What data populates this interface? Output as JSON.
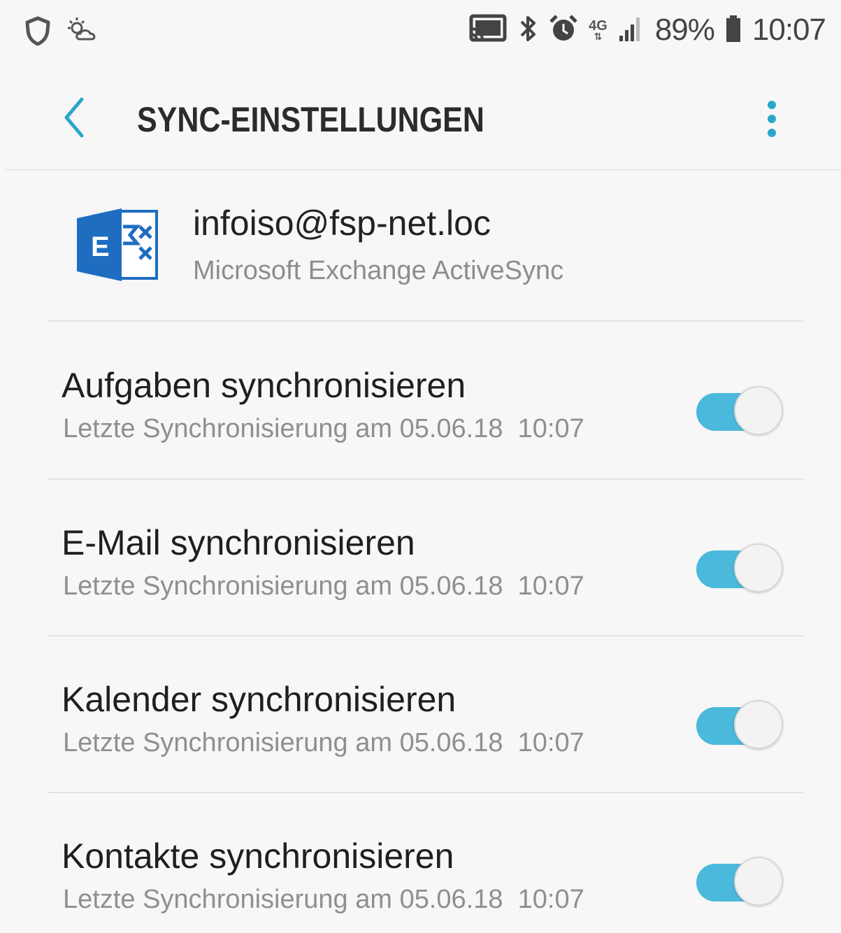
{
  "status_bar": {
    "left_icons": [
      "shield-icon",
      "weather-icon"
    ],
    "right_icons": [
      "screen-cast-icon",
      "bluetooth-icon",
      "alarm-icon",
      "network-4g-icon",
      "signal-icon",
      "battery-icon"
    ],
    "network_label": "4G",
    "battery": "89%",
    "time": "10:07"
  },
  "app_bar": {
    "title": "SYNC-EINSTELLUNGEN",
    "back_icon": "chevron-left-icon",
    "more_icon": "more-vertical-icon",
    "accent_color": "#2aa7c9"
  },
  "account": {
    "email": "infoiso@fsp-net.loc",
    "type": "Microsoft Exchange ActiveSync",
    "logo": "exchange-logo-icon",
    "logo_color": "#1e6dc1"
  },
  "sync_items": [
    {
      "title": "Aufgaben synchronisieren",
      "subtitle": "Letzte Synchronisierung am 05.06.18  10:07",
      "enabled": true
    },
    {
      "title": "E-Mail synchronisieren",
      "subtitle": "Letzte Synchronisierung am 05.06.18  10:07",
      "enabled": true
    },
    {
      "title": "Kalender synchronisieren",
      "subtitle": "Letzte Synchronisierung am 05.06.18  10:07",
      "enabled": true
    },
    {
      "title": "Kontakte synchronisieren",
      "subtitle": "Letzte Synchronisierung am 05.06.18  10:07",
      "enabled": true
    }
  ],
  "toggle_color": "#4ab9dc"
}
